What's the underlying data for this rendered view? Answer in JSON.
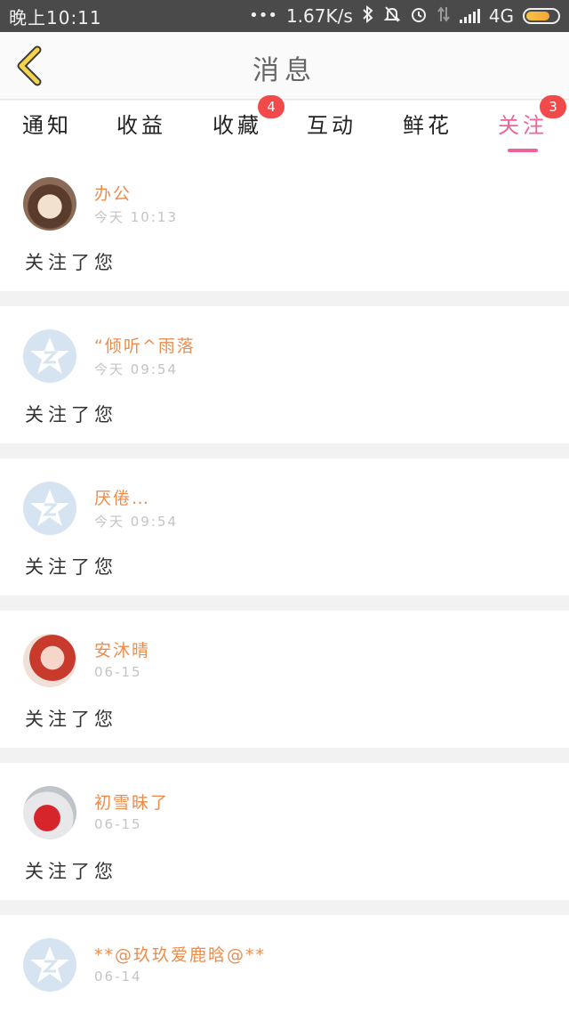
{
  "status_bar": {
    "time": "晚上10:11",
    "network_speed": "1.67K/s",
    "network_type": "4G",
    "icons": [
      "dots-icon",
      "bluetooth-icon",
      "mute-bell-icon",
      "alarm-icon",
      "data-arrows-icon",
      "signal-icon",
      "battery-icon"
    ],
    "battery_level": 0.7
  },
  "header": {
    "title": "消息",
    "back_icon": "chevron-left-icon",
    "accent_color": "#f4c542"
  },
  "tabs": [
    {
      "label": "通知",
      "badge": ""
    },
    {
      "label": "收益",
      "badge": ""
    },
    {
      "label": "收藏",
      "badge": "4"
    },
    {
      "label": "互动",
      "badge": ""
    },
    {
      "label": "鲜花",
      "badge": ""
    },
    {
      "label": "关注",
      "badge": "3",
      "active": true
    }
  ],
  "colors": {
    "active_tab": "#f0639a",
    "badge": "#f24a4a",
    "username": "#ee8c4b"
  },
  "messages": [
    {
      "username": "办公",
      "time": "今天 10:13",
      "text": "关注了您",
      "avatar": "photo"
    },
    {
      "username": "“倾听^雨落",
      "time": "今天 09:54",
      "text": "关注了您",
      "avatar": "default"
    },
    {
      "username": "厌倦…",
      "time": "今天 09:54",
      "text": "关注了您",
      "avatar": "default"
    },
    {
      "username": "安沐晴",
      "time": "06-15",
      "text": "关注了您",
      "avatar": "photo"
    },
    {
      "username": "初雪昧了",
      "time": "06-15",
      "text": "关注了您",
      "avatar": "photo"
    },
    {
      "username": "**@玖玖爱鹿晗@**",
      "time": "06-14",
      "text": "",
      "avatar": "default"
    }
  ]
}
